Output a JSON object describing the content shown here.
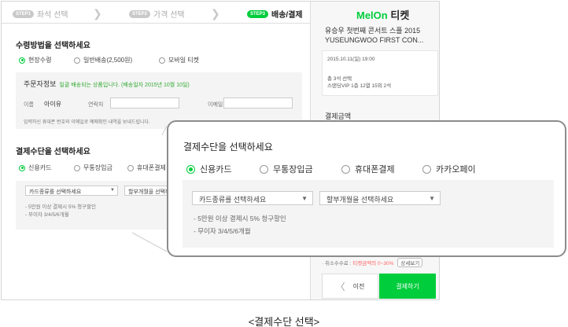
{
  "steps": [
    {
      "badge": "STEP1",
      "label": "좌석 선택"
    },
    {
      "badge": "STEP2",
      "label": "가격 선택"
    },
    {
      "badge": "STEP3",
      "label": "배송/결제"
    }
  ],
  "receive": {
    "title": "수령방법을 선택하세요",
    "options": [
      "현장수령",
      "일반배송(2,500원)",
      "모바일 티켓"
    ]
  },
  "order": {
    "title": "주문자정보",
    "note": "일괄 배송되는 상품입니다. (배송일자 2015년 10월 10일)",
    "name_label": "이름",
    "name_value": "아이유",
    "phone_label": "연락처",
    "email_label": "이메일",
    "hint": "입력하신 휴대폰 번호와 이메일로 예매확인 내역을 보내드립니다."
  },
  "payment": {
    "title": "결제수단을 선택하세요",
    "options": [
      "신용카드",
      "무통장입금",
      "휴대폰결제",
      "카카오페이"
    ],
    "card_select": "카드종류를 선택하세요",
    "installment_select": "할부개월을 선택하세요",
    "notes": [
      "- 5만원 이상 결제시 5% 청구할인",
      "- 무이자 3/4/5/6개월"
    ]
  },
  "sidebar": {
    "brand": "MelOn",
    "brand_suffix": "티켓",
    "concert_title": "유승우 첫번째 콘서트 스플 2015 YUSEUNGWOO FIRST CON...",
    "date": "2015.10.11(일) 19:00",
    "total": "총 3석 선택",
    "seat": "스탠딩VIP 1층 12열 15외 2석",
    "pay_amount_label": "결제금액",
    "fee_text": "· 취소수수료 :",
    "fee_highlight": "티켓금액의 0~30%",
    "fee_detail_btn": "상세보기",
    "prev_label": "이전",
    "pay_label": "결제하기"
  },
  "caption": "<결제수단 선택>"
}
